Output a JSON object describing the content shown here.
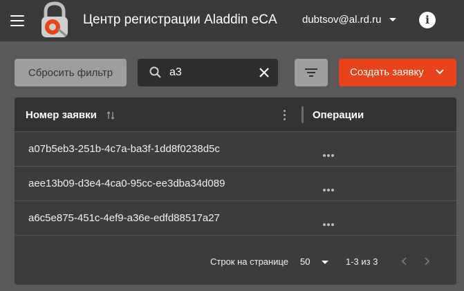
{
  "header": {
    "title": "Центр регистрации Aladdin eCA",
    "user": "dubtsov@al.rd.ru",
    "icons": [
      "menu-icon",
      "aladdin-logo",
      "chevron-down-icon",
      "info-icon"
    ]
  },
  "toolbar": {
    "reset_label": "Сбросить фильтр",
    "search_value": "а3",
    "create_label": "Создать заявку"
  },
  "table": {
    "columns": [
      "Номер заявки",
      "Операции"
    ],
    "rows": [
      {
        "id": "a07b5eb3-251b-4c7a-ba3f-1dd8f0238d5c"
      },
      {
        "id": "aee13b09-d3e4-4ca0-95cc-ee3dba34d089"
      },
      {
        "id": "a6c5e875-451c-4ef9-a36e-edfd88517a27"
      }
    ]
  },
  "pagination": {
    "rows_per_page_label": "Строк на странице",
    "rows_per_page": "50",
    "range": "1-3 из 3"
  },
  "colors": {
    "topbar": "#3a3a3a",
    "background": "#595959",
    "accent": "#e8431a",
    "button_gray": "#9e9e9e",
    "table": "#3c3c3c"
  }
}
